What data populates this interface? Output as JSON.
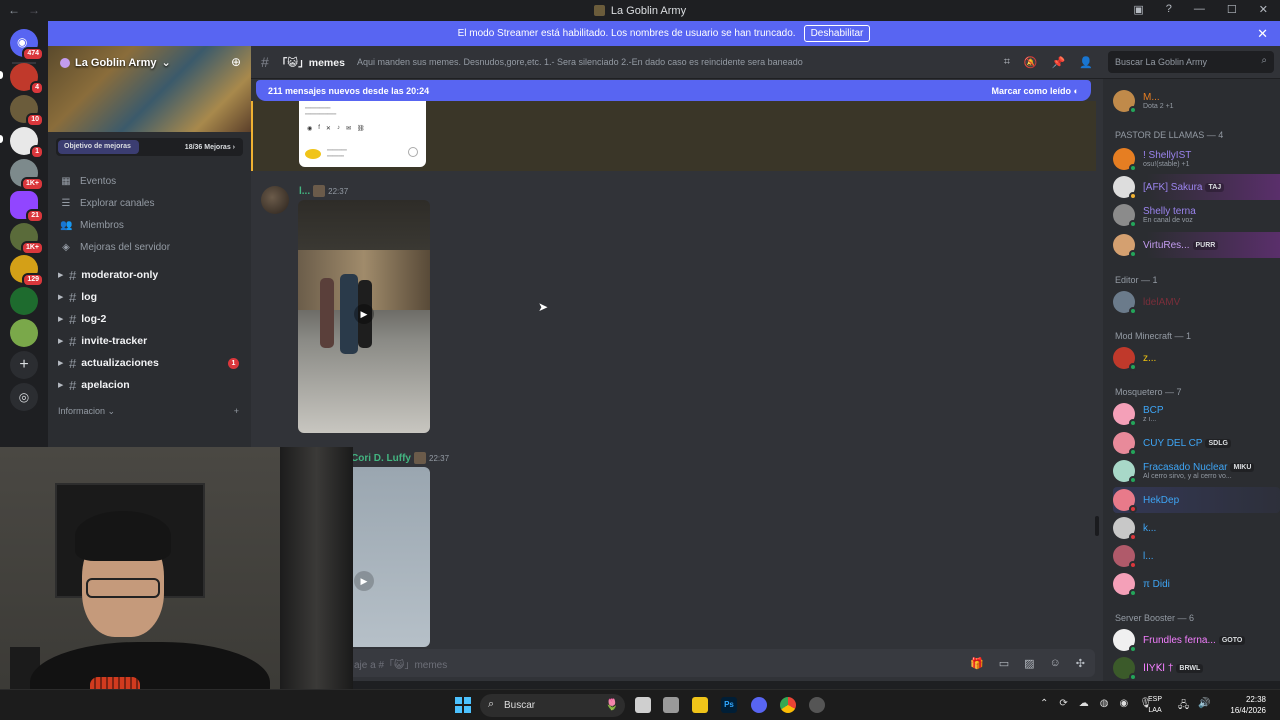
{
  "window": {
    "title": "La Goblin Army"
  },
  "banner": {
    "text": "El modo Streamer está habilitado. Los nombres de usuario se han truncado.",
    "button": "Deshabilitar"
  },
  "rail": {
    "badges": [
      "474",
      "4",
      "10",
      "1",
      "1K+",
      "21",
      "1K+",
      "129"
    ]
  },
  "server": {
    "name": "La Goblin Army",
    "boost_label": "Objetivo de mejoras",
    "boost_progress": "18/36 Mejoras",
    "nav": [
      {
        "label": "Eventos",
        "icon": "calendar-icon"
      },
      {
        "label": "Explorar canales",
        "icon": "list-icon"
      },
      {
        "label": "Miembros",
        "icon": "members-icon"
      },
      {
        "label": "Mejoras del servidor",
        "icon": "boost-icon"
      }
    ],
    "channels": [
      {
        "name": "moderator-only"
      },
      {
        "name": "log"
      },
      {
        "name": "log-2"
      },
      {
        "name": "invite-tracker"
      },
      {
        "name": "actualizaciones",
        "unread": "1"
      },
      {
        "name": "apelacion"
      }
    ],
    "category": "Informacion"
  },
  "channel": {
    "name": "「😺」memes",
    "topic": "Aqui manden sus memes. Desnudos,gore,etc. 1.- Sera silenciado 2.-En dado caso es reincidente sera baneado",
    "search_placeholder": "Buscar La Goblin Army"
  },
  "chat": {
    "new_messages": "211 mensajes nuevos desde las 20:24",
    "mark_read": "Marcar como leído",
    "messages": [
      {
        "author": "l...",
        "time": "22:37"
      },
      {
        "author": "Cori D. Luffy",
        "time": "22:37"
      }
    ],
    "composer_placeholder": "aje a #「😺」memes"
  },
  "members": {
    "categories": [
      {
        "label": "PASTOR DE LLAMAS — 4"
      },
      {
        "label": "Editor — 1"
      },
      {
        "label": "Mod Minecraft — 1"
      },
      {
        "label": "Mosquetero — 7"
      },
      {
        "label": "Server Booster — 6"
      }
    ],
    "list": [
      {
        "name": "M...",
        "sub": "Dota 2 +1",
        "color": "#e67e22"
      },
      {
        "name": "! ShellyIST",
        "sub": "osu!(stable) +1",
        "color": "#9b84ee"
      },
      {
        "name": "[AFK] Sakura",
        "tag": "TAJ",
        "color": "#9b84ee"
      },
      {
        "name": "Shelly terna",
        "sub": "En canal de voz",
        "color": "#9b84ee"
      },
      {
        "name": "VirtuRes...",
        "tag": "PURR",
        "color": "#c39cf0"
      },
      {
        "name": "ldelAMV",
        "color": "#7a2e3a"
      },
      {
        "name": "z...",
        "color": "#f1c40f"
      },
      {
        "name": "BCP",
        "sub": "z ı...",
        "color": "#3ea5f5"
      },
      {
        "name": "CUY DEL CP",
        "tag": "SDLG",
        "color": "#3ea5f5"
      },
      {
        "name": "Fracasado Nuclear",
        "tag": "MIKU",
        "sub": "Al cerro sirvo, y al cerro vo...",
        "color": "#3ea5f5"
      },
      {
        "name": "HekDep",
        "color": "#3ea5f5"
      },
      {
        "name": "k...",
        "color": "#3ea5f5"
      },
      {
        "name": "l...",
        "color": "#3ea5f5"
      },
      {
        "name": "π Didi",
        "color": "#3ea5f5"
      },
      {
        "name": "Frundles ferna...",
        "tag": "GOTO",
        "color": "#f47fff"
      },
      {
        "name": "ꓲꓲYꓗꓲ †",
        "tag": "BRWL",
        "color": "#f47fff"
      }
    ]
  },
  "taskbar": {
    "search": "Buscar",
    "lang_top": "ESP",
    "lang_bottom": "LAA",
    "time": "22:38",
    "date": "16/4/2026"
  },
  "colors": {
    "blurple": "#5865f2",
    "bg_chat": "#313338",
    "bg_sidebar": "#2b2d31",
    "unread_red": "#da373c"
  }
}
